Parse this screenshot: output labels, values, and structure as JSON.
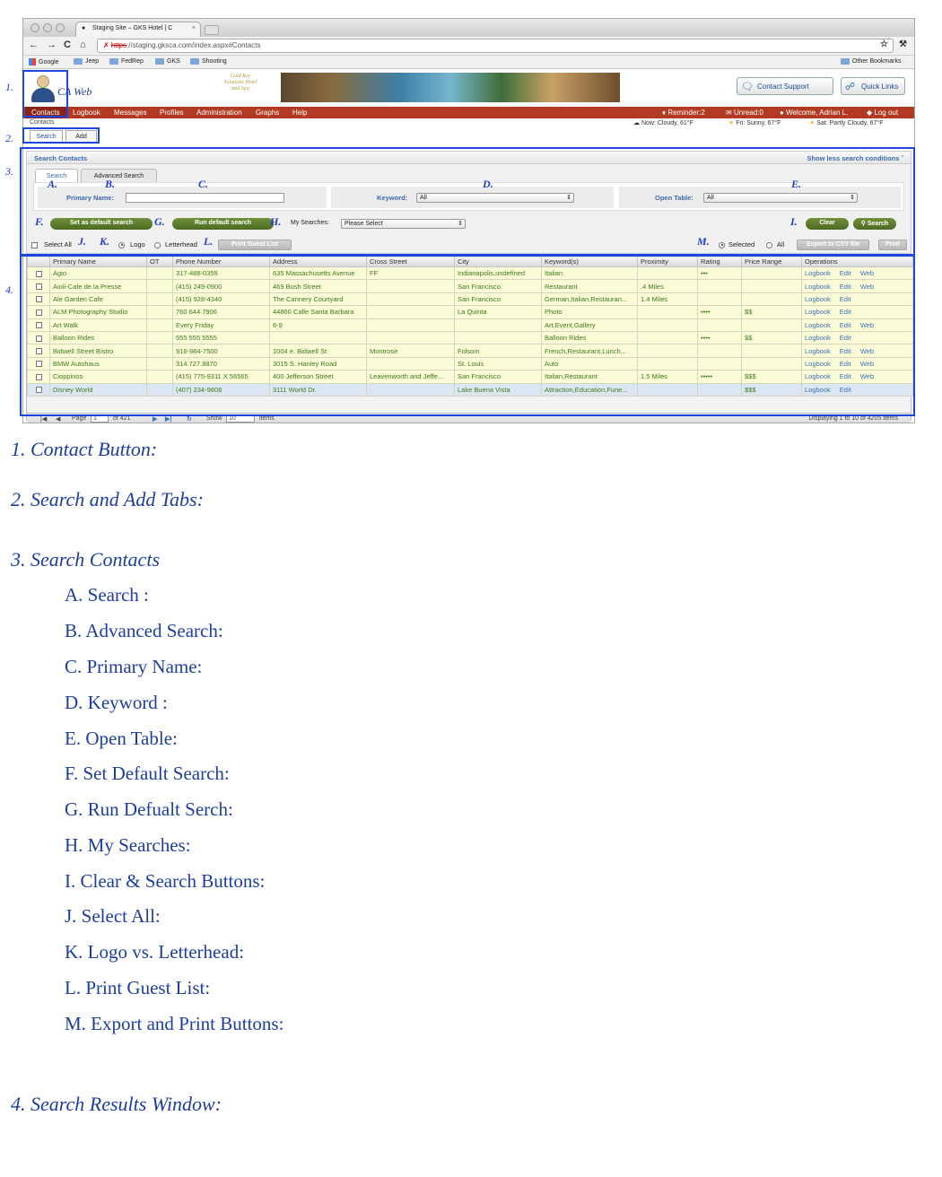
{
  "browser": {
    "tab_title": "Staging Site – GKS Hotel | C",
    "url_scheme": "https",
    "url_rest": "://staging.gksca.com/index.aspx#Contacts",
    "bookmarks": [
      "Google",
      "Jeep",
      "FedRep",
      "GKS",
      "Shooting"
    ],
    "other_bookmarks": "Other Bookmarks"
  },
  "header": {
    "app_name": "CA Web",
    "hotel_logo_text": "Gold Key Solutions Hotel and Spa",
    "contact_support": "Contact Support",
    "quick_links": "Quick Links"
  },
  "menu": {
    "items": [
      "Contacts",
      "Logbook",
      "Messages",
      "Profiles",
      "Administration",
      "Graphs",
      "Help"
    ],
    "reminder": "Reminder:2",
    "unread": "Unread:0",
    "welcome": "Welcome, Adrian L.",
    "logout": "Log out"
  },
  "subrow": {
    "breadcrumb": "Contacts",
    "weather_now": "Now: Cloudy, 61°F",
    "weather_fri": "Fri: Sunny, 67°F",
    "weather_sat": "Sat: Partly Cloudy, 67°F"
  },
  "top_tabs": {
    "search": "Search",
    "add": "Add"
  },
  "search_panel": {
    "title": "Search Contacts",
    "less_conditions": "Show less search conditions",
    "tab_search": "Search",
    "tab_advanced": "Advanced Search",
    "primary_name_label": "Primary Name:",
    "primary_name_value": "",
    "keyword_label": "Keyword:",
    "keyword_value": "All",
    "open_table_label": "Open Table:",
    "open_table_value": "All",
    "set_default": "Set as default search",
    "run_default": "Run default search",
    "my_searches_label": "My Searches:",
    "my_searches_value": "Please Select",
    "clear": "Clear",
    "search": "Search",
    "select_all": "Select All",
    "logo": "Logo",
    "letterhead": "Letterhead",
    "print_guest_list": "Print Guest List",
    "selected": "Selected",
    "all": "All",
    "export_csv": "Export to CSV file",
    "print": "Print"
  },
  "grid": {
    "columns": [
      "",
      "Primary Name",
      "OT",
      "Phone Number",
      "Address",
      "Cross Street",
      "City",
      "Keyword(s)",
      "Proximity",
      "Rating",
      "Price Range",
      "Operations"
    ],
    "rows": [
      {
        "name": "Agio",
        "ot": "",
        "phone": "317-488-0359",
        "address": "635 Massachusetts Avenue",
        "cross": "FF",
        "city": "Indianapolis,undefined",
        "keywords": "Italian",
        "proximity": "",
        "rating": "•••",
        "price": "",
        "ops": [
          "Logbook",
          "Edit",
          "Web"
        ]
      },
      {
        "name": "Aioli-Cafe de la Presse",
        "ot": "",
        "phone": "(415) 249-0900",
        "address": "469 Bush Street",
        "cross": "",
        "city": "San Francisco",
        "keywords": "Restaurant",
        "proximity": ".4 Miles",
        "rating": "",
        "price": "",
        "ops": [
          "Logbook",
          "Edit",
          "Web"
        ]
      },
      {
        "name": "Ale Garden Cafe",
        "ot": "",
        "phone": "(415) 928-4340",
        "address": "The Cannery Courtyard",
        "cross": "",
        "city": "San Francisco",
        "keywords": "German,Italian,Restauran...",
        "proximity": "1.4 Miles",
        "rating": "",
        "price": "",
        "ops": [
          "Logbook",
          "Edit"
        ]
      },
      {
        "name": "ALM Photography Studio",
        "ot": "",
        "phone": "760 644 7906",
        "address": "44860 Calle Santa Barbara",
        "cross": "",
        "city": "La Quinta",
        "keywords": "Photo",
        "proximity": "",
        "rating": "••••",
        "price": "$$",
        "ops": [
          "Logbook",
          "Edit"
        ]
      },
      {
        "name": "Art Walk",
        "ot": "",
        "phone": "Every Friday",
        "address": "6-9",
        "cross": "",
        "city": "",
        "keywords": "Art,Event,Gallery",
        "proximity": "",
        "rating": "",
        "price": "",
        "ops": [
          "Logbook",
          "Edit",
          "Web"
        ]
      },
      {
        "name": "Balloon Rides",
        "ot": "",
        "phone": "555 555 5555",
        "address": "",
        "cross": "",
        "city": "",
        "keywords": "Balloon Rides",
        "proximity": "",
        "rating": "••••",
        "price": "$$",
        "ops": [
          "Logbook",
          "Edit"
        ]
      },
      {
        "name": "Bidwell Street Bistro",
        "ot": "",
        "phone": "916-984-7500",
        "address": "1004 e. Bidwell St",
        "cross": "Montrose",
        "city": "Folsom",
        "keywords": "French,Restaurant,Lunch...",
        "proximity": "",
        "rating": "",
        "price": "",
        "ops": [
          "Logbook",
          "Edit",
          "Web"
        ]
      },
      {
        "name": "BMW Autohaus",
        "ot": "",
        "phone": "314.727.8870",
        "address": "3015 S. Hanley Road",
        "cross": "",
        "city": "St. Louis",
        "keywords": "Auto",
        "proximity": "",
        "rating": "",
        "price": "",
        "ops": [
          "Logbook",
          "Edit",
          "Web"
        ]
      },
      {
        "name": "Cioppinos",
        "ot": "",
        "phone": "(415) 775-9311 X 56565",
        "address": "400 Jefferson Street",
        "cross": "Leavenworth and Jeffe...",
        "city": "San Francisco",
        "keywords": "Italian,Restaurant",
        "proximity": "1.5 Miles",
        "rating": "•••••",
        "price": "$$$",
        "ops": [
          "Logbook",
          "Edit",
          "Web"
        ]
      },
      {
        "name": "Disney World",
        "ot": "",
        "phone": "(407) 234-9808",
        "address": "3111 World Dr.",
        "cross": "",
        "city": "Lake Buena Vista",
        "keywords": "Attraction,Education,Fune...",
        "proximity": "",
        "rating": "",
        "price": "$$$",
        "ops": [
          "Logbook",
          "Edit"
        ]
      }
    ],
    "page_label": "Page",
    "page_value": "1",
    "of_pages": "of 421",
    "show_label": "Show",
    "show_value": "10",
    "items_label": "items",
    "displaying": "Displaying 1 to 10 of 4205 items"
  },
  "markers": {
    "n1": "1.",
    "n2": "2.",
    "n3": "3.",
    "n4": "4.",
    "A": "A.",
    "B": "B.",
    "C": "C.",
    "D": "D.",
    "E": "E.",
    "F": "F.",
    "G": "G.",
    "H": "H.",
    "I": "I.",
    "J": "J.",
    "K": "K.",
    "L": "L.",
    "M": "M."
  },
  "annotations": {
    "item1": "1.  Contact Button:",
    "item2": "2.  Search and Add Tabs:",
    "item3": "3.  Search Contacts",
    "sub": [
      "A. Search :",
      "B. Advanced Search:",
      "C. Primary Name:",
      "D. Keyword :",
      "E. Open Table:",
      "F. Set Default Search:",
      "G. Run Defualt Serch:",
      "H. My Searches:",
      "I. Clear & Search Buttons:",
      "J. Select All:",
      "K. Logo vs. Letterhead:",
      "L. Print Guest List:",
      "M. Export and Print Buttons:"
    ],
    "item4": "4.  Search Results Window:"
  },
  "colors": {
    "accent_blue": "#1d45e0",
    "menu_red": "#b33a22",
    "button_green": "#5a7a2c",
    "row_yellow": "#fbfbd8",
    "link_green": "#3d7a1a"
  },
  "icons": [
    "back-icon",
    "forward-icon",
    "reload-icon",
    "home-icon",
    "star-icon",
    "wrench-icon",
    "folder-icon",
    "cloud-icon",
    "sun-icon"
  ]
}
